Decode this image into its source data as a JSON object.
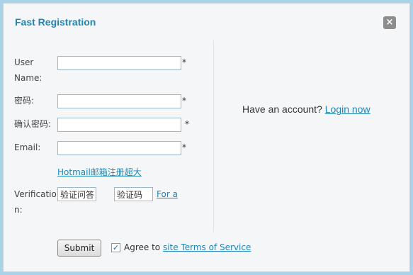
{
  "dialog": {
    "title": "Fast Registration",
    "close_label": "×"
  },
  "form": {
    "username_label_1": "User",
    "username_label_2": "Name:",
    "password_label": "密码:",
    "confirm_password_label": "确认密码:",
    "email_label": "Email:",
    "hotmail_link": "Hotmail邮箱注册超大",
    "verification_label_1": "Verificatio",
    "verification_label_2": "n:",
    "verification_question_value": "验证问答",
    "verification_code_value": "验证码",
    "for_a_link": "For a",
    "required_mark": "*"
  },
  "account": {
    "prompt": "Have an account?",
    "login_link": "Login now"
  },
  "footer": {
    "submit_label": "Submit",
    "agree_text": "Agree to",
    "terms_link": "site Terms of Service",
    "agree_checked": true
  }
}
